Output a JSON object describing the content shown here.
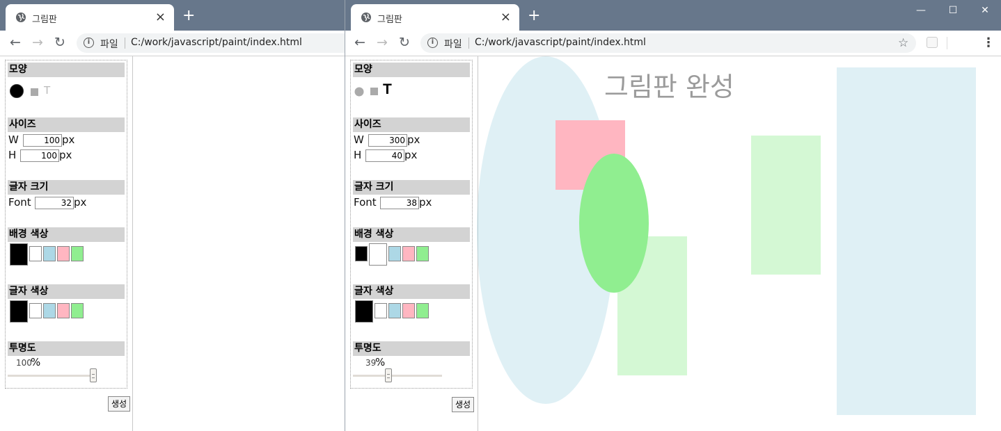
{
  "left_window": {
    "tab_title": "그림판",
    "address": {
      "scheme": "파일",
      "url": "C:/work/javascript/paint/index.html"
    },
    "panel": {
      "shape_header": "모양",
      "text_icon": "T",
      "size_header": "사이즈",
      "w_label": "W",
      "w_value": "100",
      "w_unit": "px",
      "h_label": "H",
      "h_value": "100",
      "h_unit": "px",
      "font_header": "글자 크기",
      "font_label": "Font",
      "font_value": "32",
      "font_unit": "px",
      "bg_header": "배경 색상",
      "fg_header": "글자 색상",
      "opacity_header": "투명도",
      "opacity_value": "100",
      "opacity_unit": "%",
      "opacity_level": 1.0,
      "selected_shape": "circle",
      "selected_bg": "black",
      "selected_fg": "black"
    },
    "create_button": "생성"
  },
  "right_window": {
    "tab_title": "그림판",
    "address": {
      "scheme": "파일",
      "url": "C:/work/javascript/paint/index.html"
    },
    "panel": {
      "shape_header": "모양",
      "text_icon": "T",
      "size_header": "사이즈",
      "w_label": "W",
      "w_value": "300",
      "w_unit": "px",
      "h_label": "H",
      "h_value": "40",
      "h_unit": "px",
      "font_header": "글자 크기",
      "font_label": "Font",
      "font_value": "38",
      "font_unit": "px",
      "bg_header": "배경 색상",
      "fg_header": "글자 색상",
      "opacity_header": "투명도",
      "opacity_value": "39",
      "opacity_unit": "%",
      "opacity_level": 0.39,
      "selected_shape": "text",
      "selected_bg": "white",
      "selected_fg": "black"
    },
    "create_button": "생성",
    "canvas_text": "그림판 완성",
    "canvas_text_opacity": 0.39
  },
  "palette": {
    "black": "#000000",
    "white": "#ffffff",
    "lightblue": "#add8e6",
    "pink": "#ffb6c1",
    "lightgreen": "#90ee90"
  },
  "icons": [
    "globe-icon",
    "tab-close-icon",
    "new-tab-icon",
    "back-arrow-icon",
    "forward-arrow-icon",
    "reload-icon",
    "info-icon",
    "bookmark-star-icon",
    "extension-icon",
    "menu-kebab-icon",
    "minimize-icon",
    "maximize-icon",
    "window-close-icon"
  ]
}
